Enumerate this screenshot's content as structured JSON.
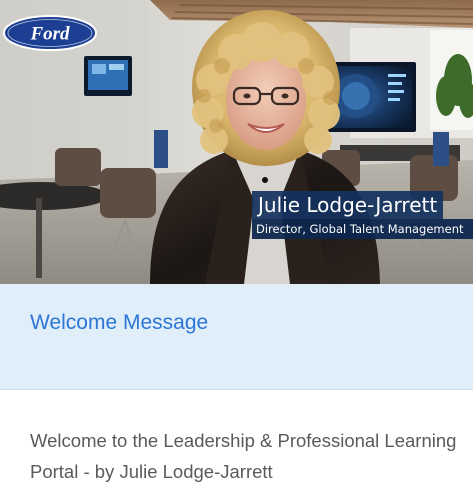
{
  "hero": {
    "logo_text": "Ford",
    "presenter_name": "Julie Lodge-Jarrett",
    "presenter_title": "Director, Global Talent Management"
  },
  "section": {
    "title": "Welcome Message"
  },
  "body": {
    "description": "Welcome to the Leadership & Professional Learning Portal - by Julie Lodge-Jarrett"
  },
  "colors": {
    "link_blue": "#2d76d6",
    "header_bg": "#e0eefa",
    "ford_blue": "#1c3f94",
    "lower_third": "#14325f",
    "body_text": "#5a5a5a"
  }
}
